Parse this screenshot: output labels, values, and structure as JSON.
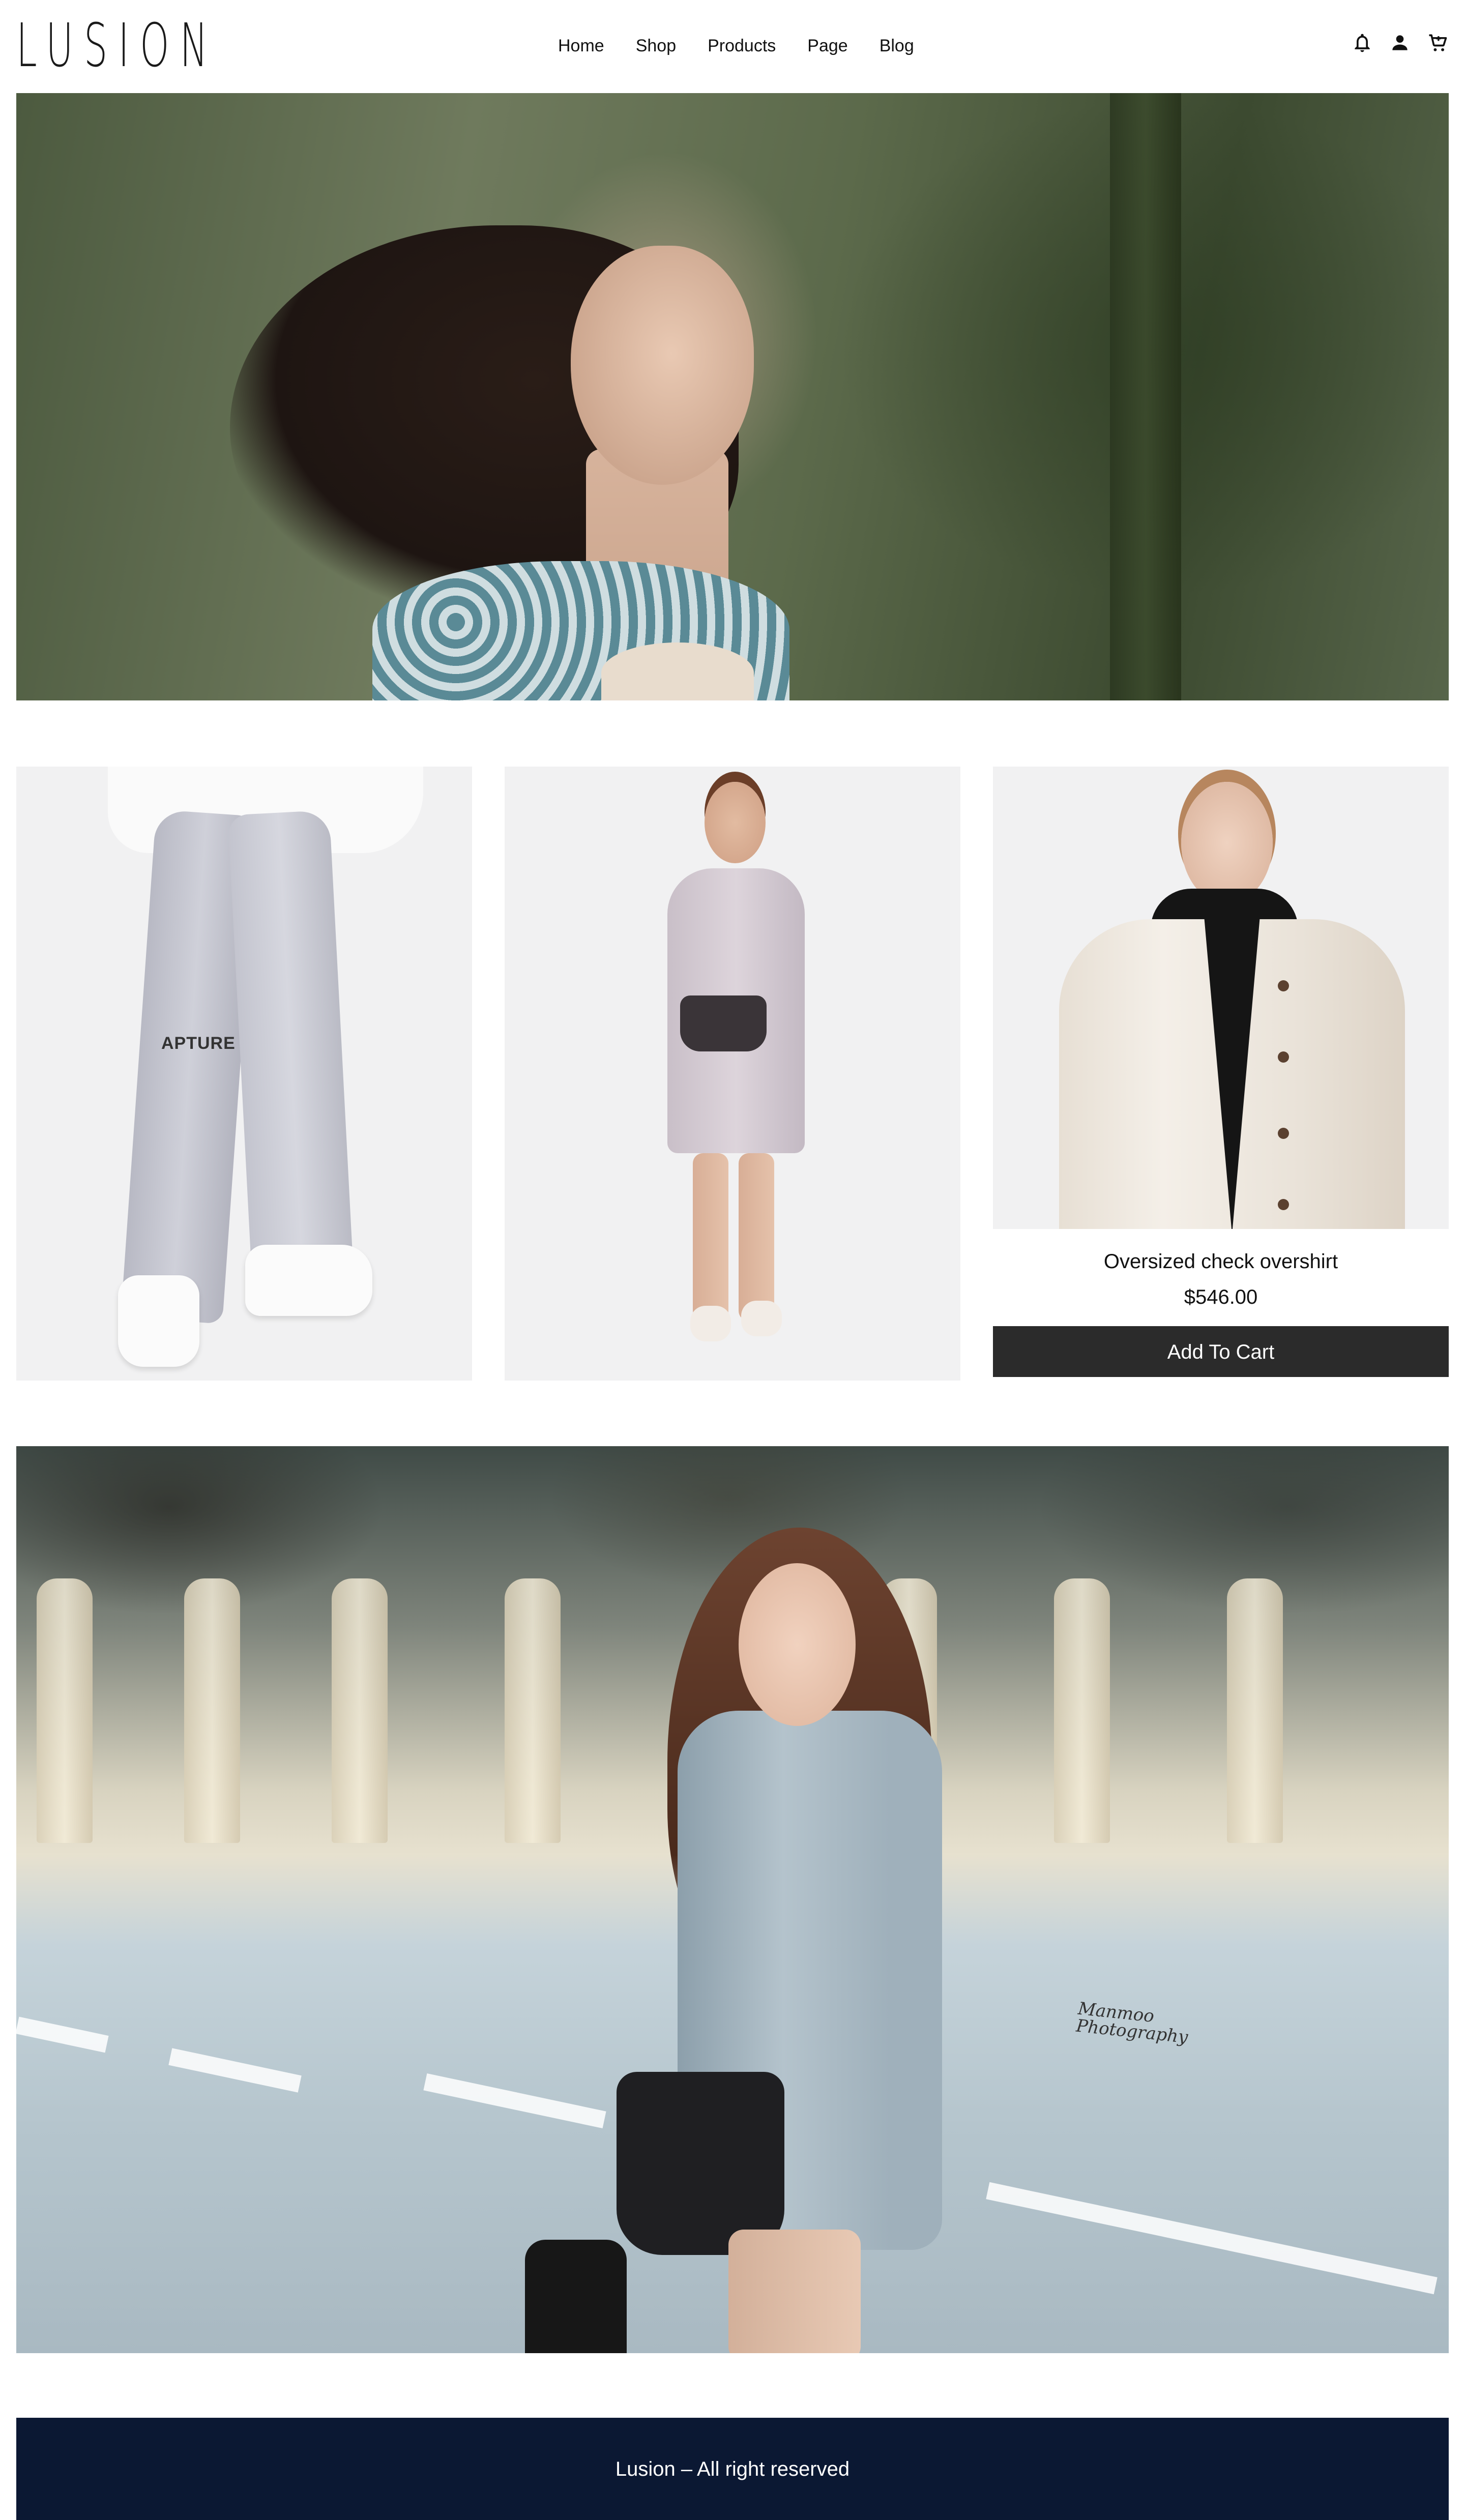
{
  "header": {
    "logo": "LUSION",
    "nav": [
      "Home",
      "Shop",
      "Products",
      "Page",
      "Blog"
    ],
    "icons": [
      "bell-icon",
      "user-icon",
      "cart-icon"
    ]
  },
  "products": [
    {
      "image": "grey cargo jogger pants with white sneakers"
    },
    {
      "image": "lilac polo shirt dress with black crossbody bag"
    },
    {
      "image": "cream oversized overshirt with black hoodie",
      "name": "Oversized check overshirt",
      "price": "$546.00",
      "cta": "Add To Cart"
    }
  ],
  "products_print": "APTURE",
  "hero2_signature": "Manmoo\nPhotography",
  "footer": {
    "text": "Lusion – All right reserved"
  },
  "colors": {
    "footer_bg": "#0b1833",
    "button_bg": "#2b2b2b"
  }
}
